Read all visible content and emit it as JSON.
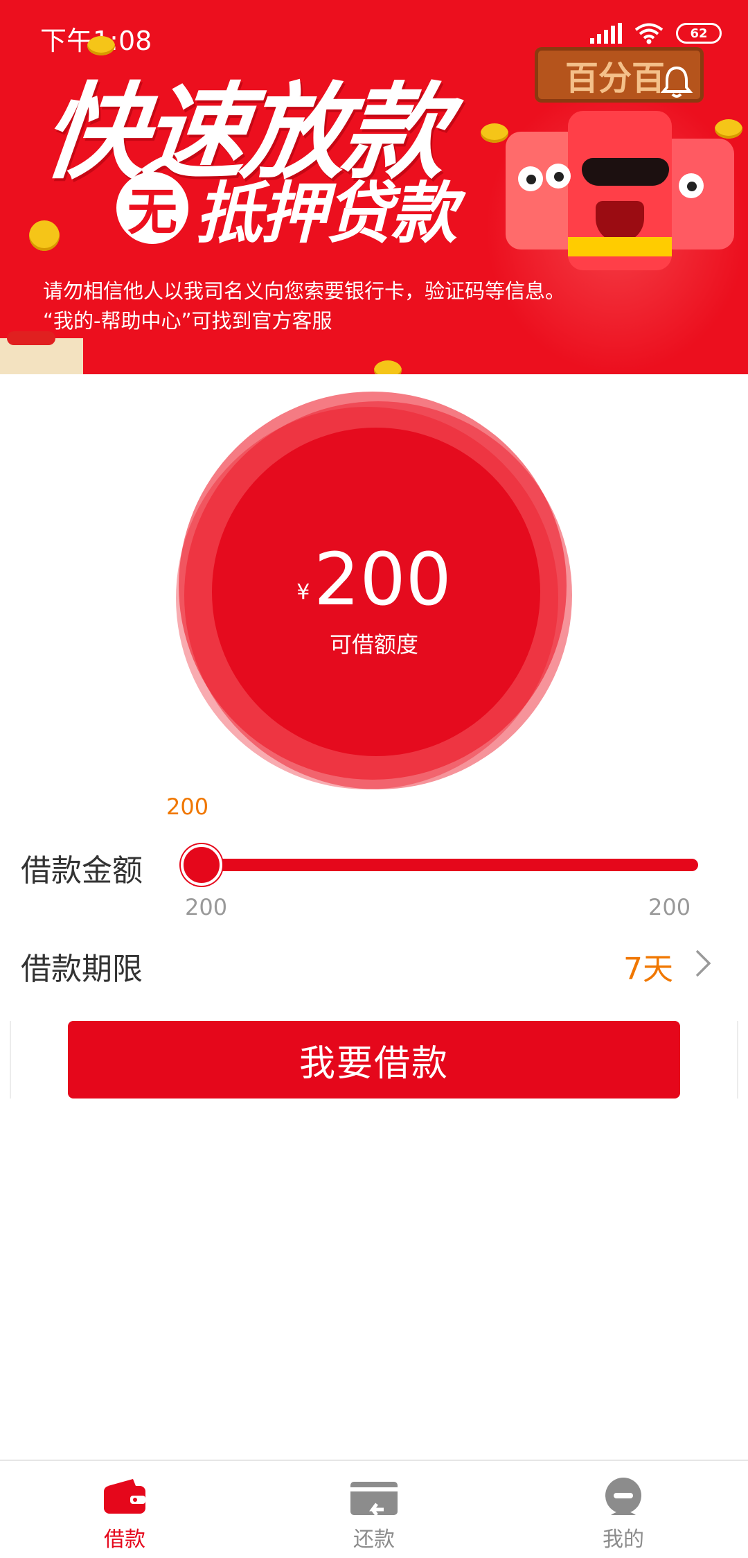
{
  "status_bar": {
    "time": "下午1:08",
    "battery": "62"
  },
  "banner": {
    "headline": "快速放款",
    "badge": "无",
    "subheadline": "抵押贷款",
    "sign_text": "百分百",
    "notice_line1": "请勿相信他人以我司名义向您索要银行卡，验证码等信息。",
    "notice_line2": "“我的-帮助中心”可找到官方客服"
  },
  "credit": {
    "currency": "¥",
    "amount": "200",
    "label": "可借额度"
  },
  "loan_amount": {
    "label": "借款金额",
    "current": "200",
    "min": "200",
    "max": "200",
    "fraction": 0
  },
  "loan_term": {
    "label": "借款期限",
    "value": "7天"
  },
  "actions": {
    "borrow_label": "我要借款"
  },
  "tabs": [
    {
      "label": "借款",
      "icon": "wallet-icon",
      "active": true
    },
    {
      "label": "还款",
      "icon": "repay-card-icon",
      "active": false
    },
    {
      "label": "我的",
      "icon": "profile-icon",
      "active": false
    }
  ],
  "colors": {
    "primary": "#e5071b",
    "accent": "#f07700",
    "muted": "#999999"
  }
}
